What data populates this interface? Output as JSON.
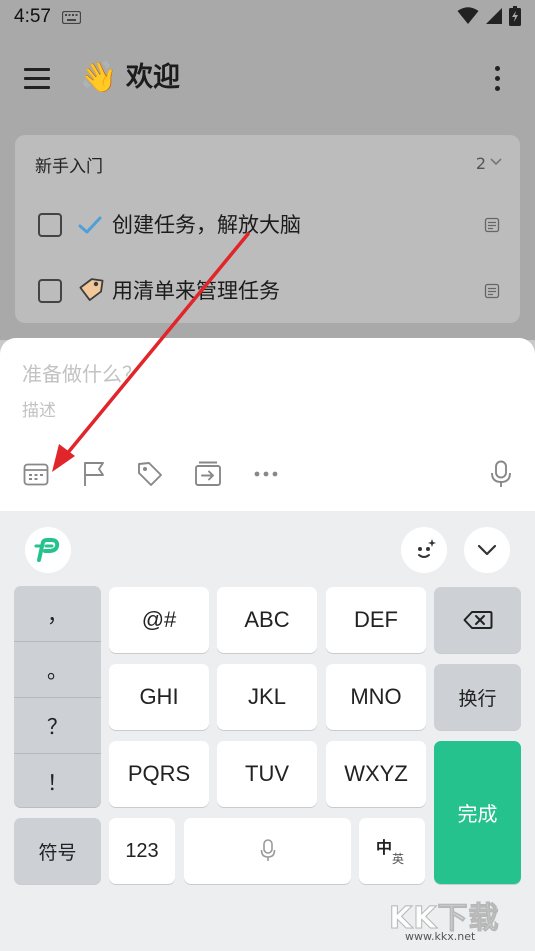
{
  "status_bar": {
    "time": "4:57"
  },
  "toolbar": {
    "emoji": "👋",
    "title": "欢迎"
  },
  "section": {
    "title": "新手入门",
    "count": "2",
    "tasks": [
      {
        "label": "创建任务，解放大脑"
      },
      {
        "label": "用清单来管理任务"
      }
    ]
  },
  "quick_add": {
    "title_placeholder": "准备做什么？",
    "description_placeholder": "描述"
  },
  "keyboard": {
    "punctuation": [
      "，",
      "。",
      "？",
      "！"
    ],
    "keys": {
      "at_hash": "@#",
      "abc": "ABC",
      "def": "DEF",
      "ghi": "GHI",
      "jkl": "JKL",
      "mno": "MNO",
      "pqrs": "PQRS",
      "tuv": "TUV",
      "wxyz": "WXYZ",
      "newline": "换行",
      "done": "完成",
      "symbols": "符号",
      "numbers": "123",
      "lang_main": "中",
      "lang_sub": "英"
    },
    "accent_color": "#26c28e"
  },
  "watermark": {
    "brand": "KK下载",
    "url": "www.kkx.net"
  },
  "colors": {
    "annotation_arrow": "#e0262a"
  }
}
